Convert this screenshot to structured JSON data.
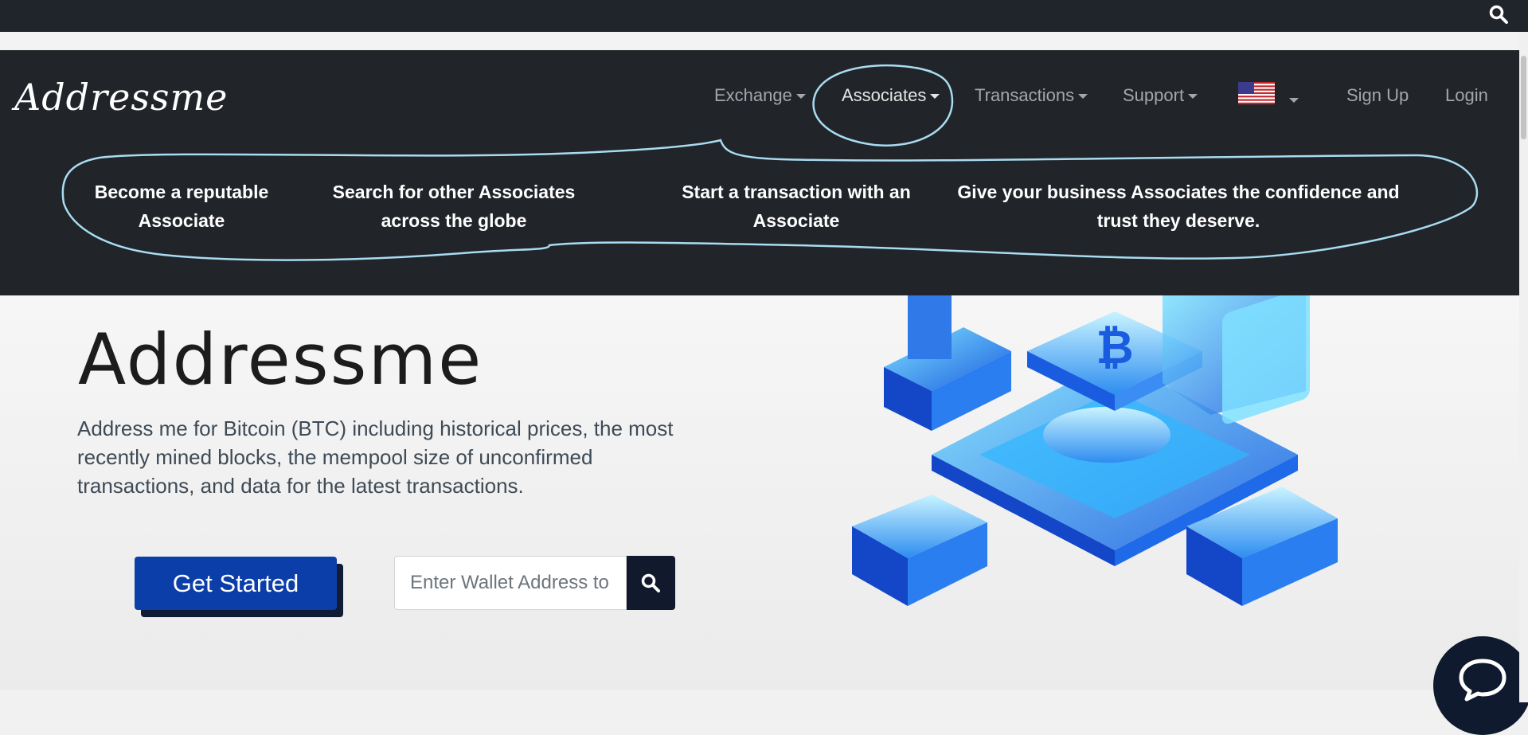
{
  "brand": "Addressme",
  "nav": {
    "exchange": "Exchange",
    "associates": "Associates",
    "transactions": "Transactions",
    "support": "Support",
    "signup": "Sign Up",
    "login": "Login"
  },
  "associates_menu": [
    "Become a reputable Associate",
    "Search for other Associates across the globe",
    "Start a transaction with an Associate",
    "Give your business Associates the confidence and trust they deserve."
  ],
  "hero": {
    "title": "Addressme",
    "description": "Address me for Bitcoin (BTC) including historical prices, the most recently mined blocks, the mempool size of unconfirmed transactions, and data for the latest transactions.",
    "cta": "Get Started",
    "search_placeholder": "Enter Wallet Address to"
  },
  "colors": {
    "navbar": "#212429",
    "button": "#0b3ea8",
    "annotation": "#a8dcf0"
  },
  "icons": [
    "search-icon",
    "us-flag-icon",
    "chat-icon",
    "bitcoin-network-illustration"
  ]
}
